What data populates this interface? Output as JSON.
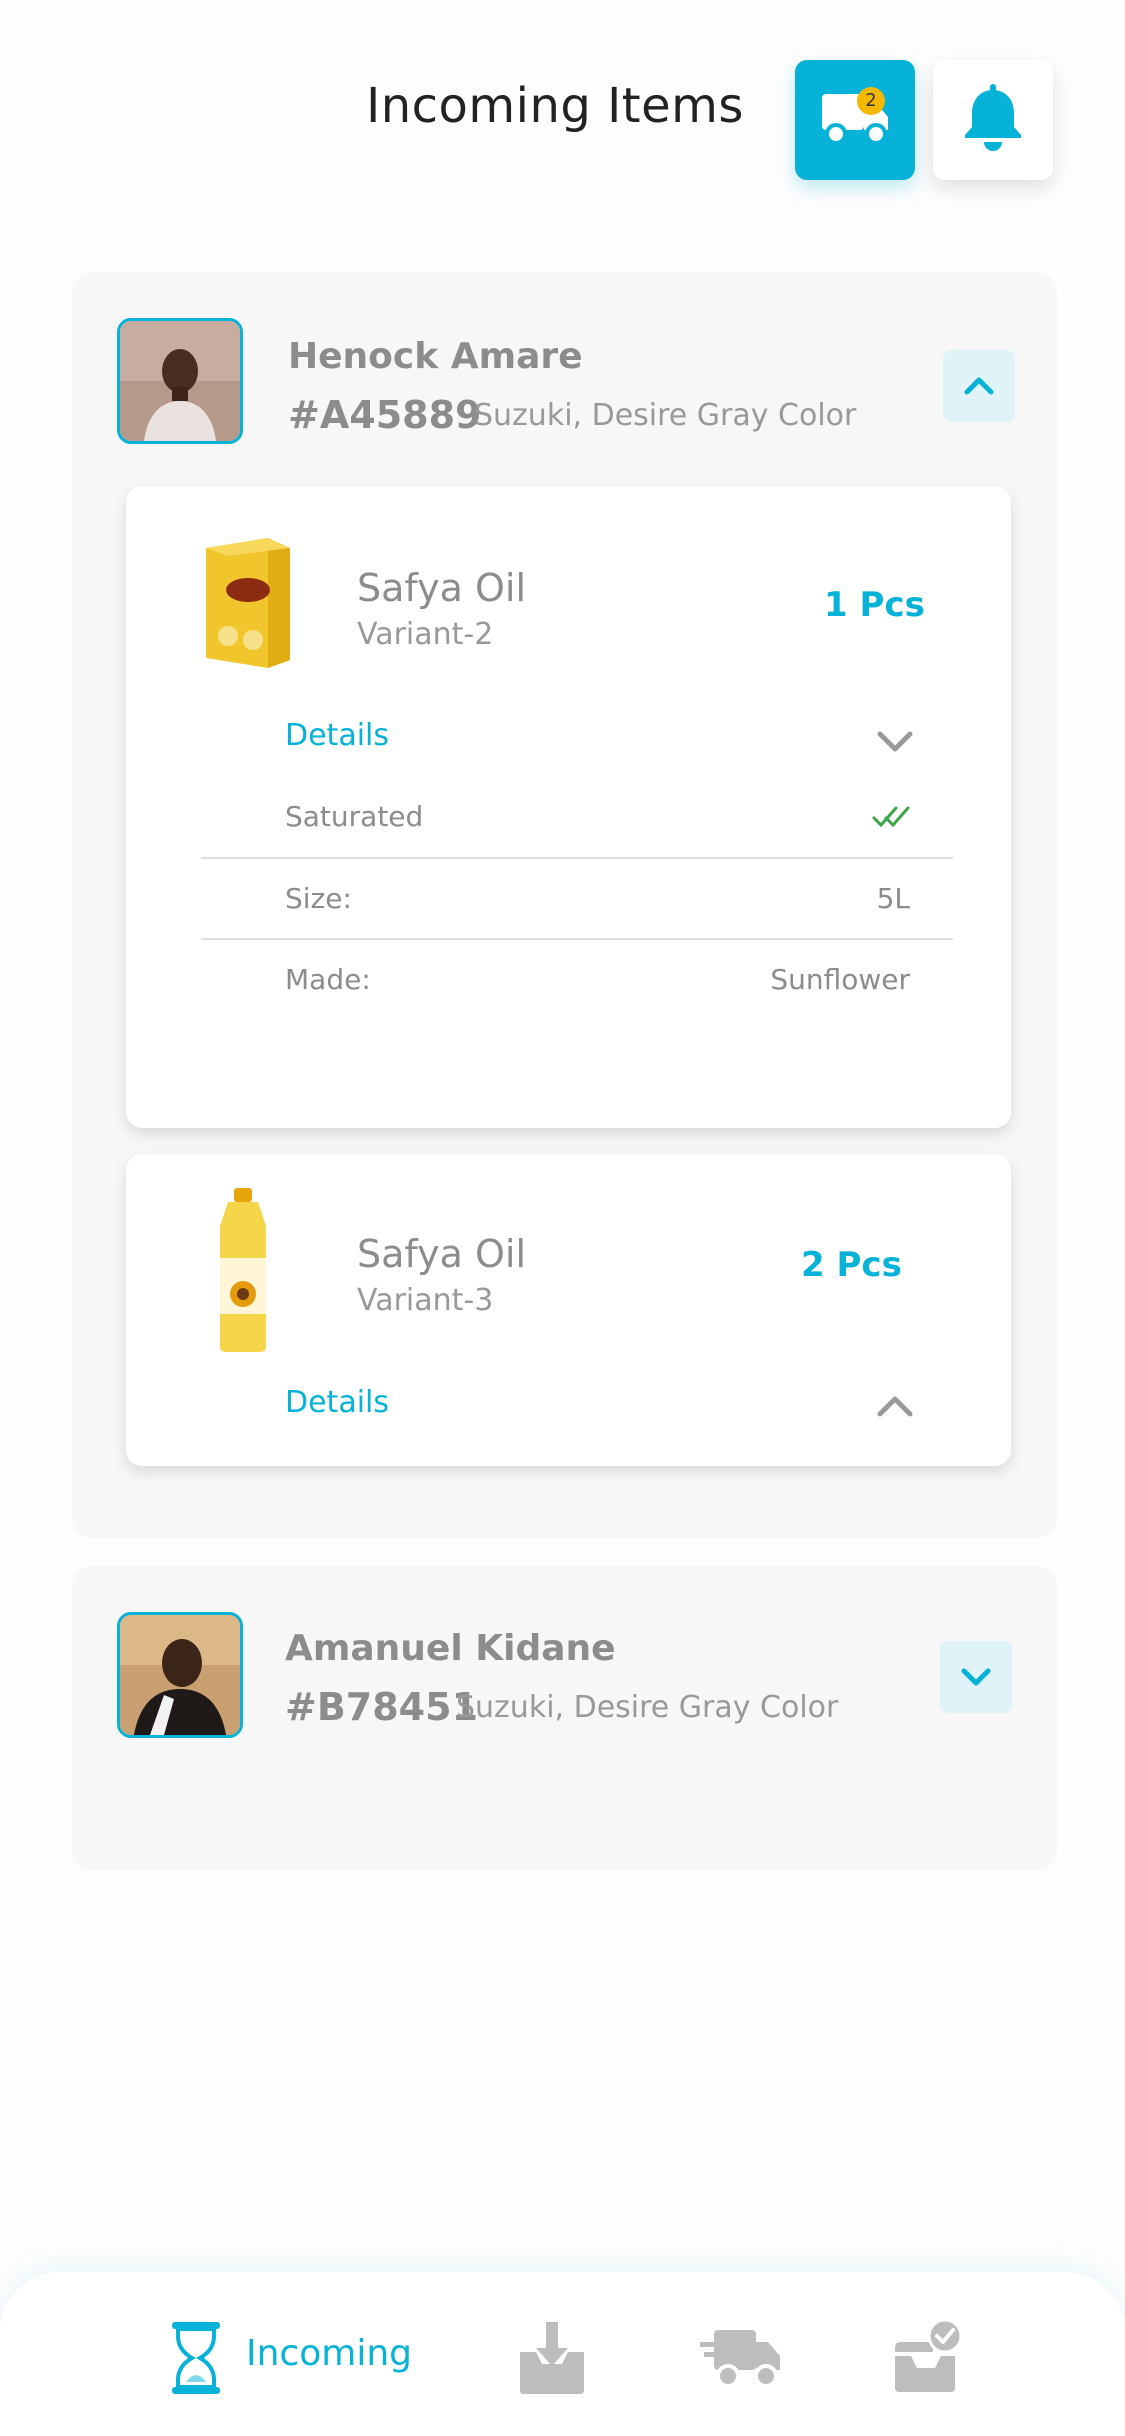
{
  "header": {
    "title": "Incoming Items",
    "truck_badge": "2"
  },
  "customers": [
    {
      "name": "Henock Amare",
      "order_id": "#A45889",
      "vehicle": "Suzuki, Desire Gray Color",
      "expanded": true,
      "items": [
        {
          "product": "Safya Oil",
          "variant": "Variant-2",
          "qty": "1 Pcs",
          "details_label": "Details",
          "details": {
            "saturated_label": "Saturated",
            "size_label": "Size:",
            "size_value": "5L",
            "made_label": "Made:",
            "made_value": "Sunflower"
          }
        },
        {
          "product": "Safya Oil",
          "variant": "Variant-3",
          "qty": "2 Pcs",
          "details_label": "Details"
        }
      ]
    },
    {
      "name": "Amanuel Kidane",
      "order_id": "#B78451",
      "vehicle": "Suzuki, Desire Gray Color",
      "expanded": false
    }
  ],
  "nav": {
    "active_label": "Incoming",
    "items": [
      "hourglass-icon",
      "download-tray-icon",
      "delivery-truck-icon",
      "inbox-check-icon"
    ]
  },
  "colors": {
    "accent": "#06b2d8",
    "badge": "#f5b800",
    "check": "#3aa845"
  }
}
